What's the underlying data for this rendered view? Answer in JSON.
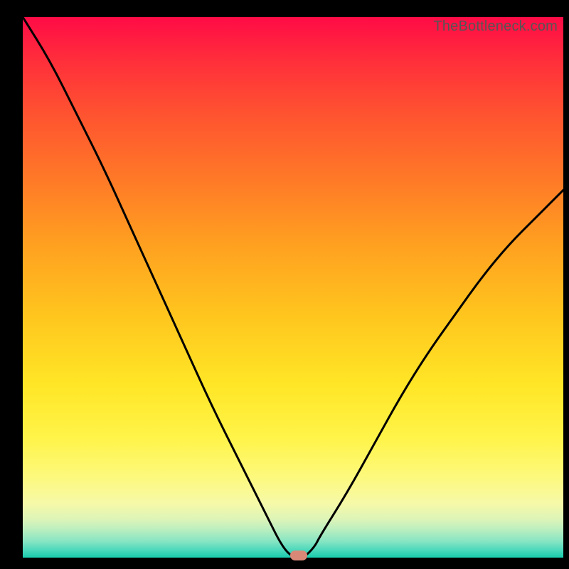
{
  "watermark": "TheBottleneck.com",
  "colors": {
    "frame": "#000000",
    "curve": "#000000",
    "marker": "#d98878",
    "gradient_top": "#ff0b46",
    "gradient_bottom": "#19ccae"
  },
  "chart_data": {
    "type": "line",
    "title": "",
    "xlabel": "",
    "ylabel": "",
    "xlim": [
      0,
      100
    ],
    "ylim": [
      0,
      100
    ],
    "series": [
      {
        "name": "bottleneck-curve",
        "x": [
          0,
          5,
          10,
          15,
          20,
          25,
          30,
          35,
          40,
          45,
          48,
          50,
          52,
          54,
          55,
          60,
          65,
          70,
          75,
          80,
          85,
          90,
          95,
          100
        ],
        "y": [
          100,
          92,
          82,
          72,
          61,
          50,
          39,
          28,
          18,
          8,
          2,
          0,
          0,
          2,
          4,
          12,
          21,
          30,
          38,
          45,
          52,
          58,
          63,
          68
        ]
      }
    ],
    "marker": {
      "x": 51,
      "y": 0
    },
    "annotations": []
  }
}
